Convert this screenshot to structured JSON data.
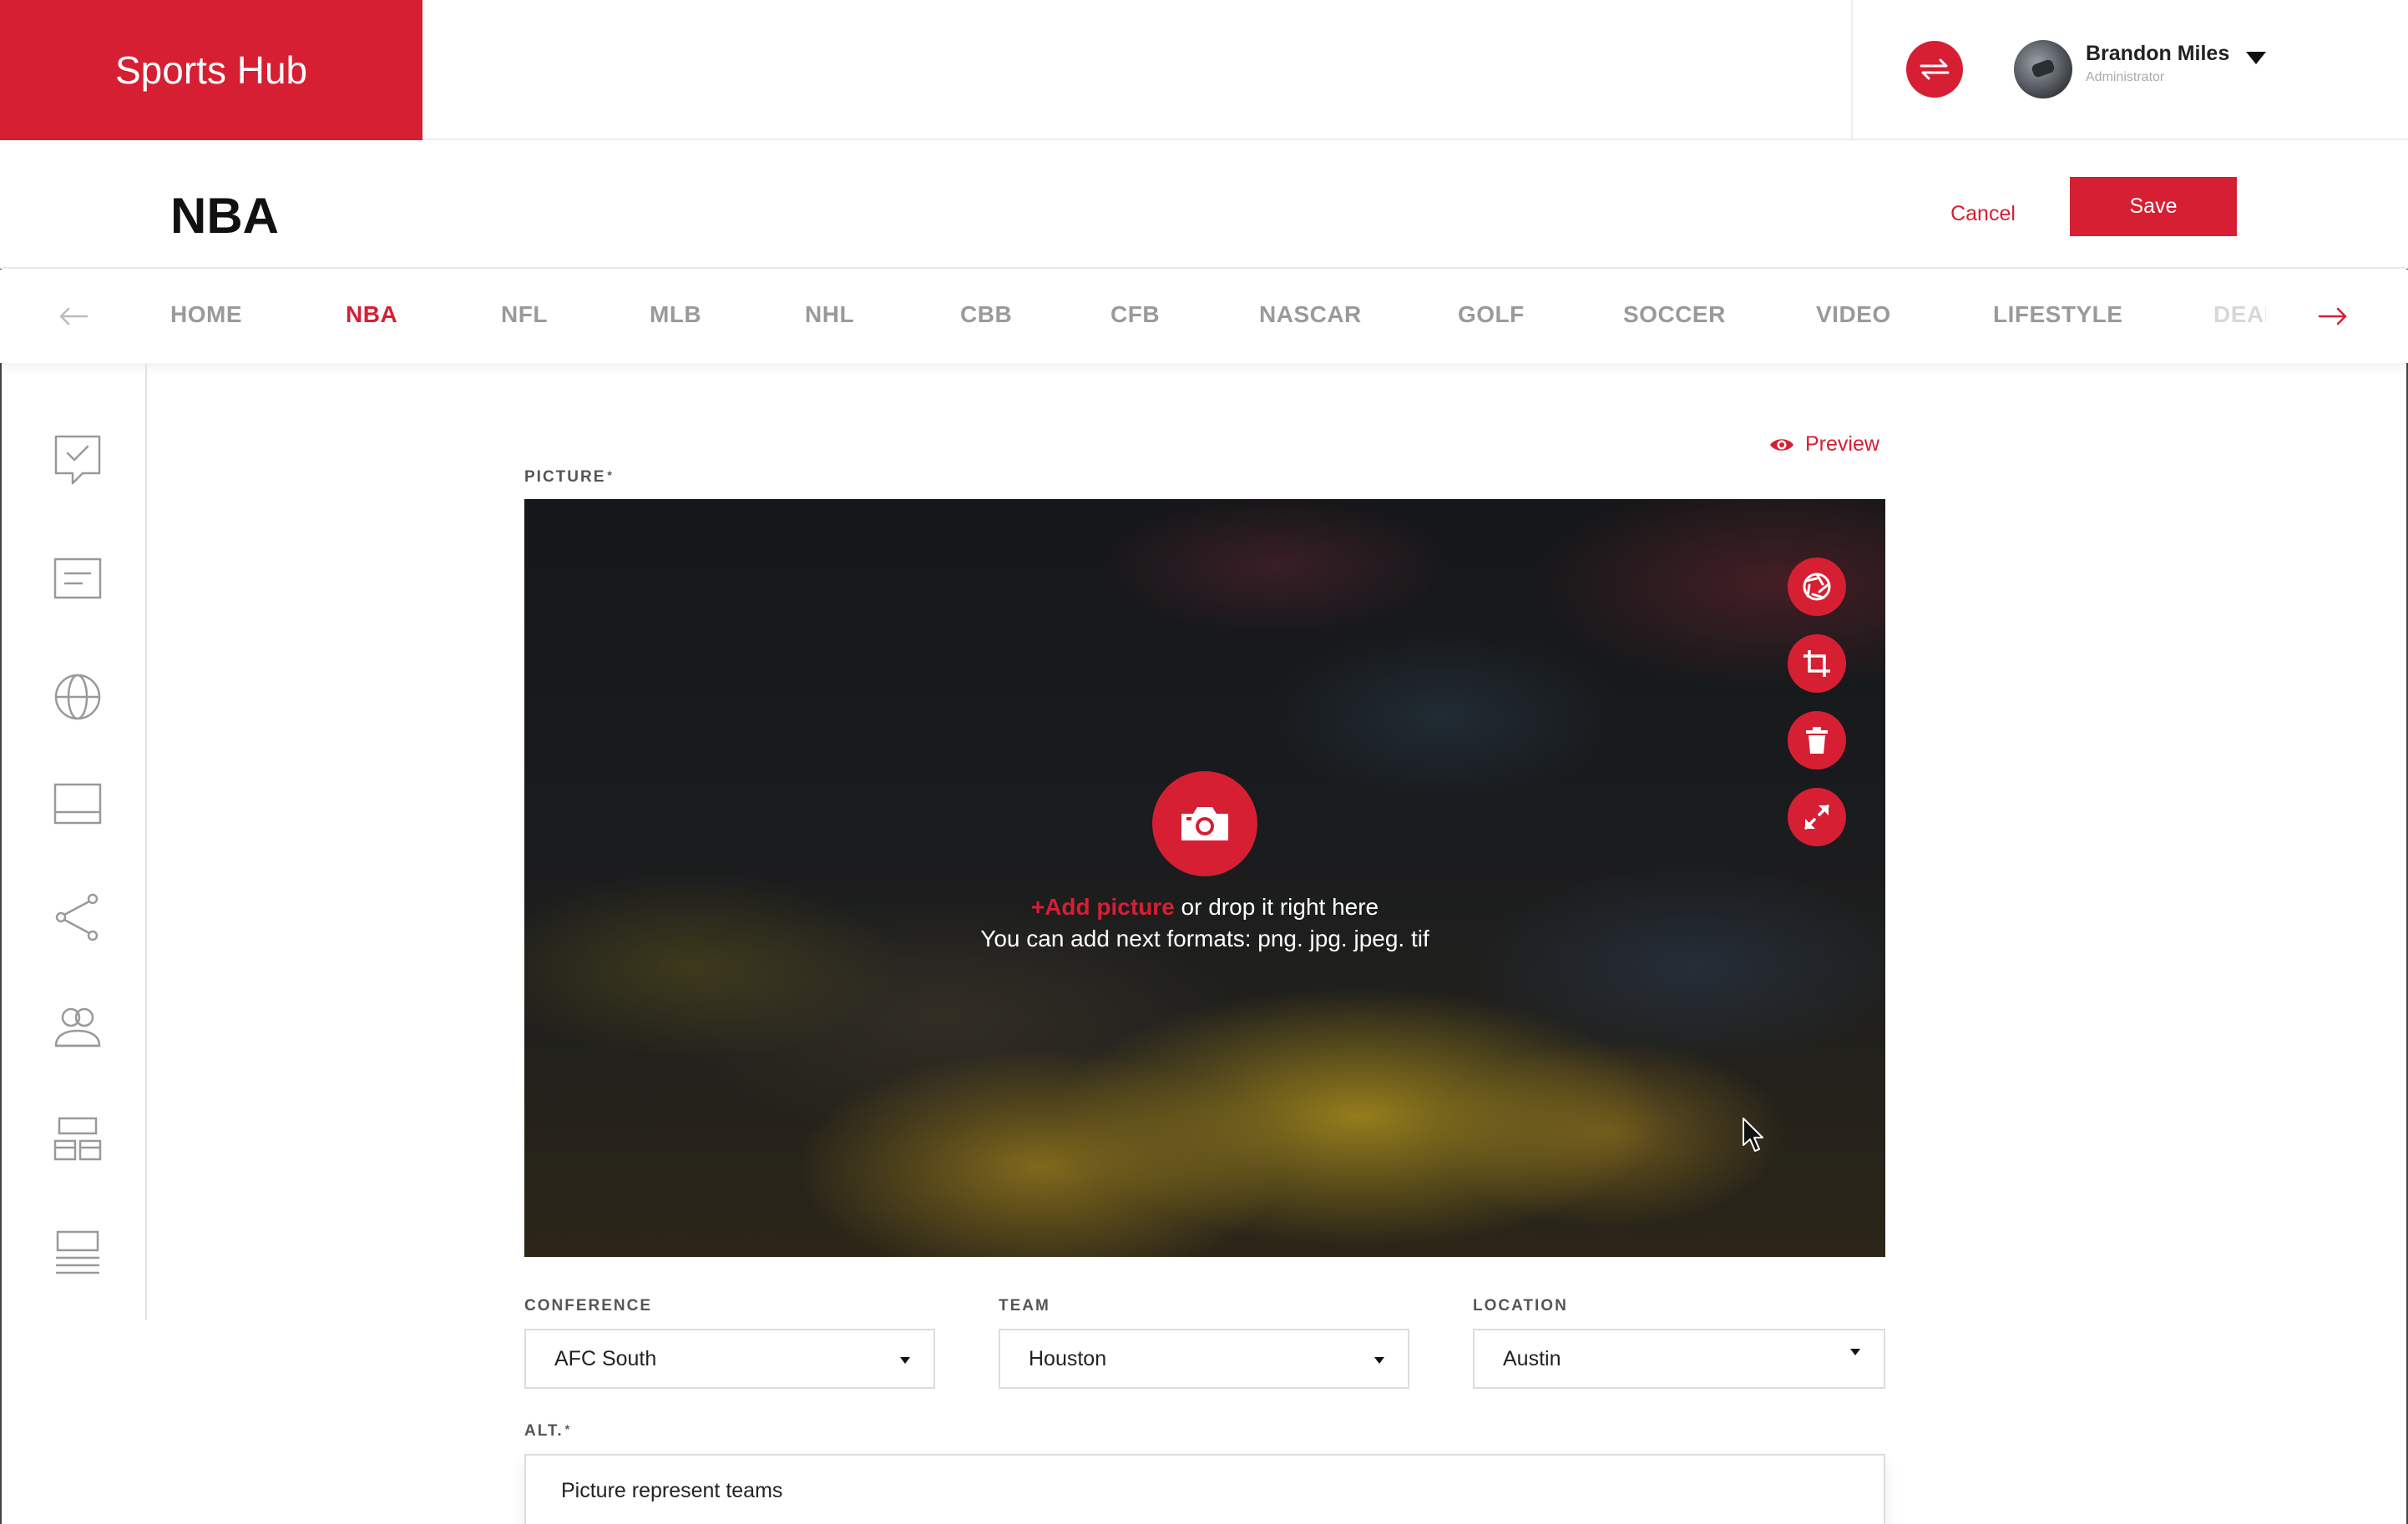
{
  "app": {
    "brand": "Sports Hub"
  },
  "user": {
    "name": "Brandon Miles",
    "role": "Administrator"
  },
  "page": {
    "title": "NBA"
  },
  "actions": {
    "cancel_label": "Cancel",
    "save_label": "Save"
  },
  "nav": {
    "items": [
      "HOME",
      "NBA",
      "NFL",
      "MLB",
      "NHL",
      "CBB",
      "CFB",
      "NASCAR",
      "GOLF",
      "SOCCER",
      "VIDEO",
      "LIFESTYLE",
      "DEALBOOK"
    ],
    "active": "NBA"
  },
  "sidebar": {
    "icons": [
      "checklist-icon",
      "article-icon",
      "globe-icon",
      "layout-icon",
      "share-icon",
      "users-icon",
      "grid-layout-icon",
      "list-layout-icon"
    ]
  },
  "preview_label": "Preview",
  "picture": {
    "label": "PICTURE",
    "required_mark": "*",
    "add_link": "+Add picture",
    "drop_text": " or drop it right here",
    "formats_text": "You can add next formats: png. jpg. jpeg. tif",
    "tools": [
      "aperture-icon",
      "crop-icon",
      "trash-icon",
      "expand-icon"
    ]
  },
  "fields": {
    "conference": {
      "label": "CONFERENCE",
      "value": "AFC South"
    },
    "team": {
      "label": "TEAM",
      "value": "Houston"
    },
    "location": {
      "label": "LOCATION",
      "value": "Austin"
    },
    "alt": {
      "label": "ALT.",
      "required_mark": "*",
      "value": "Picture represent teams"
    }
  },
  "colors": {
    "accent": "#d61f33",
    "nav_inactive": "#9a9a9a"
  }
}
